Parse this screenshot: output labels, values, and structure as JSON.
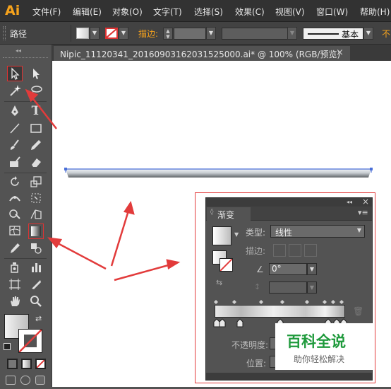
{
  "app": {
    "logo": "Ai"
  },
  "menu": [
    "文件(F)",
    "编辑(E)",
    "对象(O)",
    "文字(T)",
    "选择(S)",
    "效果(C)",
    "视图(V)",
    "窗口(W)",
    "帮助(H)"
  ],
  "control_bar": {
    "selection_label": "路径",
    "stroke_label": "描边",
    "stroke_colon": ":",
    "profile_label": "基本",
    "opacity_label_partial": "不"
  },
  "document_tab": {
    "title": "Nipic_11120341_20160903162031525000.ai* @ 100% (RGB/预览)",
    "close": "×"
  },
  "gradient_panel": {
    "collapse": "◂◂",
    "close": "×",
    "title": "渐变",
    "type_label": "类型:",
    "type_value": "线性",
    "stroke_label": "描边:",
    "angle_value": "0°",
    "opacity_label": "不透明度:",
    "location_label": "位置:"
  },
  "watermark": {
    "title": "百科全说",
    "subtitle": "助你轻松解决"
  },
  "colors": {
    "accent": "#f7a31c",
    "annotation": "#e23b3b",
    "selection": "#4a6fd8"
  }
}
